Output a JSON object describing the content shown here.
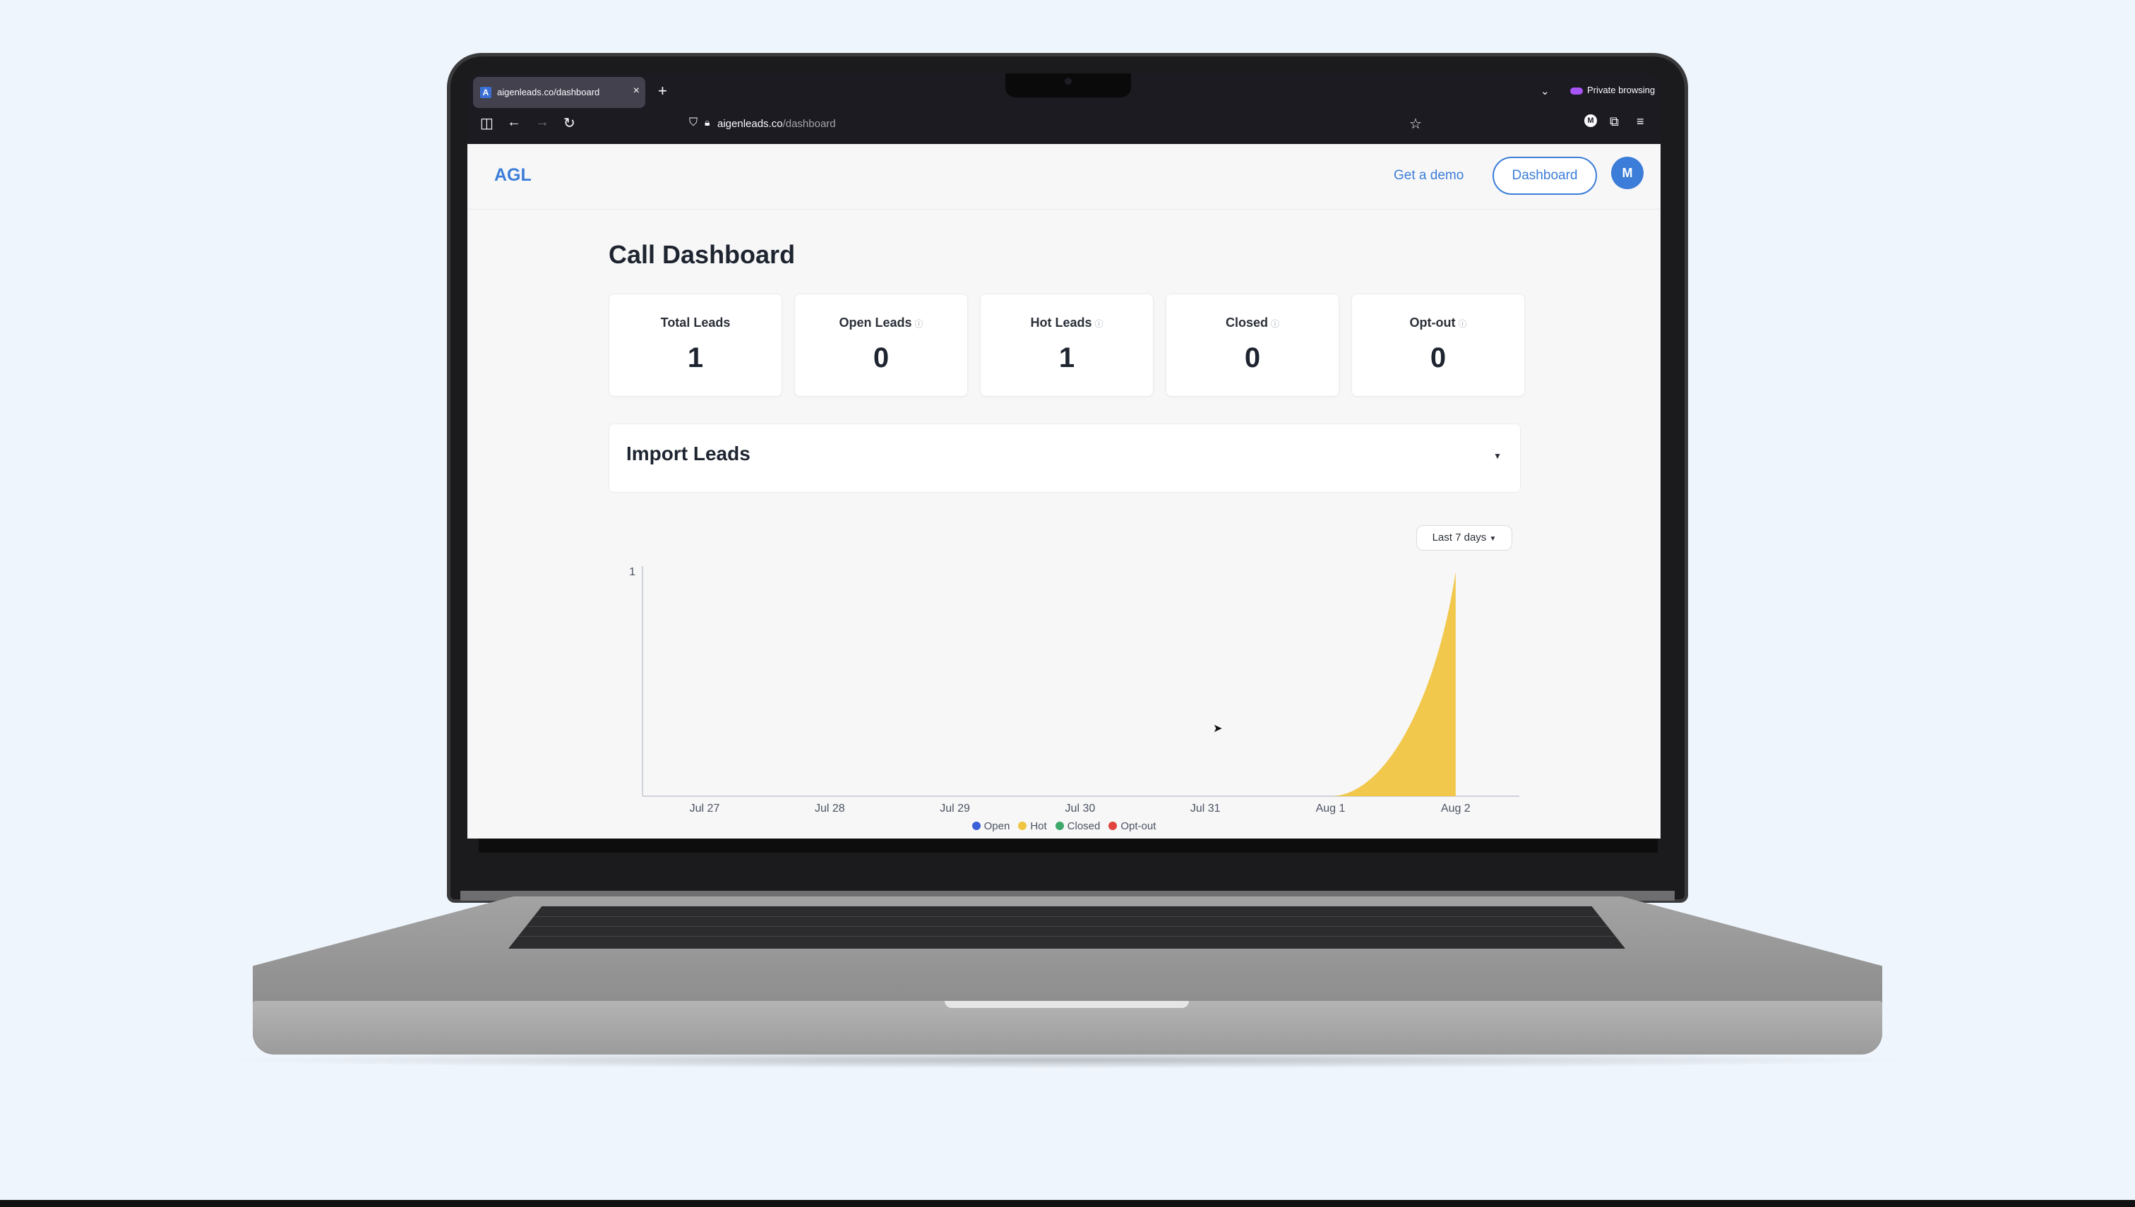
{
  "browser": {
    "tab_title": "aigenleads.co/dashboard",
    "tab_favicon": "A",
    "url_host": "aigenleads.co",
    "url_path": "/dashboard",
    "private_label": "Private browsing",
    "account_initial": "M",
    "icons": [
      "sidebar-icon",
      "back-icon",
      "forward-icon",
      "reload-icon",
      "shield-icon",
      "lock-icon",
      "star-icon",
      "extensions-icon",
      "menu-icon"
    ]
  },
  "nav": {
    "logo": "AGL",
    "demo_link": "Get a demo",
    "dashboard_button": "Dashboard",
    "avatar_initial": "M",
    "brand_color": "#3b7dd8"
  },
  "page": {
    "title": "Call Dashboard",
    "stats": [
      {
        "label": "Total Leads",
        "value": "1"
      },
      {
        "label": "Open Leads",
        "value": "0"
      },
      {
        "label": "Hot Leads",
        "value": "1"
      },
      {
        "label": "Closed",
        "value": "0"
      },
      {
        "label": "Opt-out",
        "value": "0"
      }
    ],
    "import_title": "Import Leads",
    "range_selector": "Last 7 days"
  },
  "chart_data": {
    "type": "area",
    "x": [
      "Jul 27",
      "Jul 28",
      "Jul 29",
      "Jul 30",
      "Jul 31",
      "Aug 1",
      "Aug 2"
    ],
    "series": [
      {
        "name": "Open",
        "color": "#3b5fd9",
        "values": [
          0,
          0,
          0,
          0,
          0,
          0,
          0
        ]
      },
      {
        "name": "Hot",
        "color": "#f0c541",
        "values": [
          0,
          0,
          0,
          0,
          0,
          0,
          1
        ]
      },
      {
        "name": "Closed",
        "color": "#3fa86b",
        "values": [
          0,
          0,
          0,
          0,
          0,
          0,
          0
        ]
      },
      {
        "name": "Opt-out",
        "color": "#e0443d",
        "values": [
          0,
          0,
          0,
          0,
          0,
          0,
          0
        ]
      }
    ],
    "yticks": [
      "1"
    ],
    "ylim": [
      0,
      1
    ],
    "legend": "bottom",
    "grid": false
  }
}
